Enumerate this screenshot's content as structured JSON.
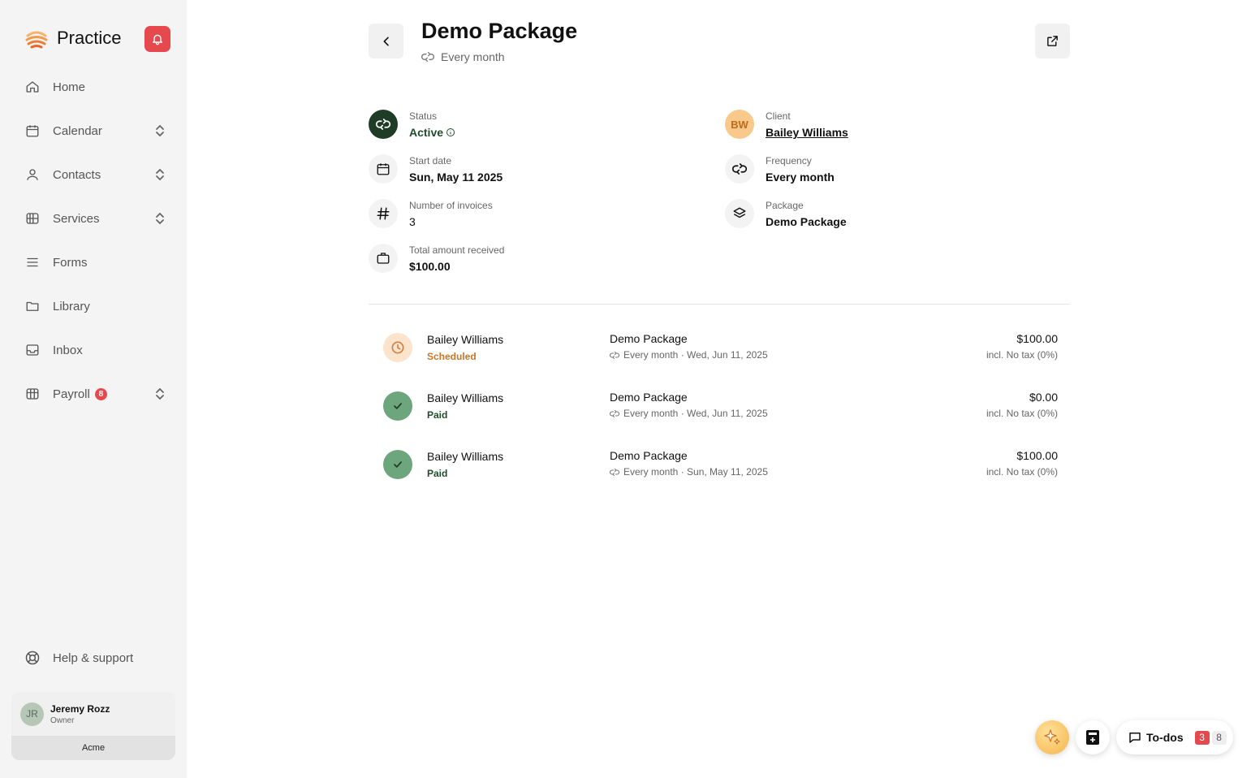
{
  "sidebar": {
    "brand": "Practice",
    "items": [
      {
        "label": "Home",
        "icon": "home-icon"
      },
      {
        "label": "Calendar",
        "icon": "calendar-icon"
      },
      {
        "label": "Contacts",
        "icon": "user-icon"
      },
      {
        "label": "Services",
        "icon": "services-icon"
      },
      {
        "label": "Forms",
        "icon": "list-icon"
      },
      {
        "label": "Library",
        "icon": "folder-icon"
      },
      {
        "label": "Inbox",
        "icon": "inbox-icon"
      },
      {
        "label": "Payroll",
        "icon": "payroll-icon",
        "badge": "8"
      }
    ],
    "help": "Help & support",
    "user": {
      "initials": "JR",
      "name": "Jeremy Rozz",
      "role": "Owner",
      "org": "Acme"
    }
  },
  "header": {
    "title": "Demo Package",
    "subtitle": "Every month"
  },
  "details": {
    "status": {
      "label": "Status",
      "value": "Active"
    },
    "client": {
      "label": "Client",
      "value": "Bailey Williams",
      "initials": "BW"
    },
    "start_date": {
      "label": "Start date",
      "value": "Sun, May 11 2025"
    },
    "frequency": {
      "label": "Frequency",
      "value": "Every month"
    },
    "invoices": {
      "label": "Number of invoices",
      "value": "3"
    },
    "package": {
      "label": "Package",
      "value": "Demo Package"
    },
    "total": {
      "label": "Total amount received",
      "value": "$100.00"
    }
  },
  "invoices": [
    {
      "client": "Bailey Williams",
      "status": "Scheduled",
      "package": "Demo Package",
      "meta": "Every month · Wed, Jun 11, 2025",
      "amount": "$100.00",
      "tax": "incl. No tax (0%)"
    },
    {
      "client": "Bailey Williams",
      "status": "Paid",
      "package": "Demo Package",
      "meta": "Every month · Wed, Jun 11, 2025",
      "amount": "$0.00",
      "tax": "incl. No tax (0%)"
    },
    {
      "client": "Bailey Williams",
      "status": "Paid",
      "package": "Demo Package",
      "meta": "Every month · Sun, May 11, 2025",
      "amount": "$100.00",
      "tax": "incl. No tax (0%)"
    }
  ],
  "floating": {
    "todos_label": "To-dos",
    "todos_urgent": "3",
    "todos_total": "8"
  },
  "colors": {
    "accent_dark_green": "#1f3d26",
    "paid_green": "#6da67c",
    "scheduled_orange": "#c8762a",
    "alert_red": "#e5484d"
  }
}
